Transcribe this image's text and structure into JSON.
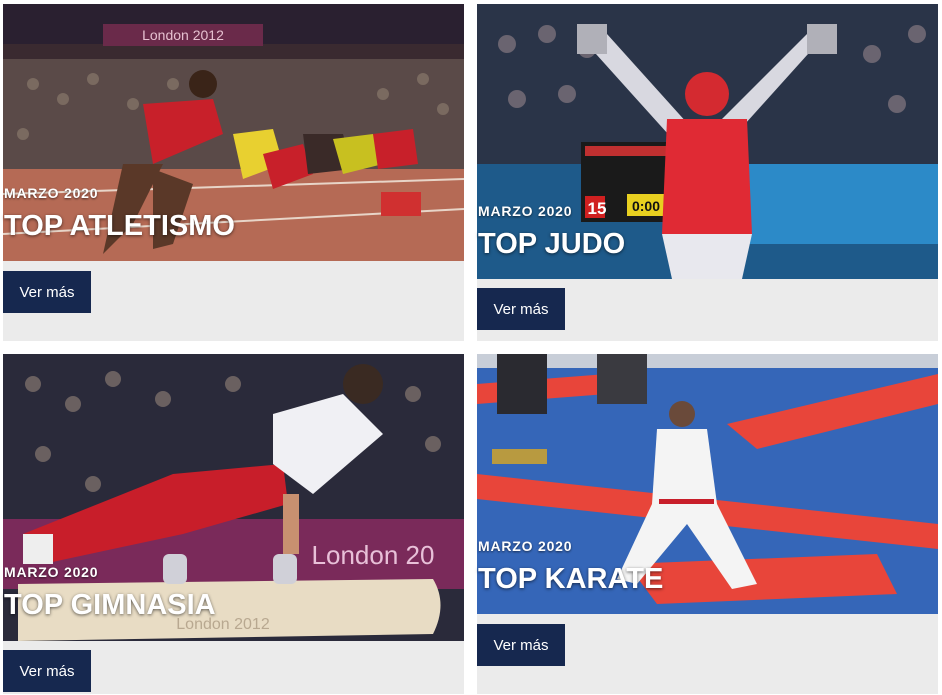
{
  "cards": [
    {
      "date": "MARZO 2020",
      "title": "TOP ATLETISMO",
      "button": "Ver más",
      "image_icon": "athletics-photo"
    },
    {
      "date": "MARZO 2020",
      "title": "TOP JUDO",
      "button": "Ver más",
      "image_icon": "judo-photo"
    },
    {
      "date": "MARZO 2020",
      "title": "TOP GIMNASIA",
      "button": "Ver más",
      "image_icon": "gymnastics-photo"
    },
    {
      "date": "MARZO 2020",
      "title": "TOP KARATE",
      "button": "Ver más",
      "image_icon": "karate-photo"
    }
  ],
  "image_text": {
    "banner_top": "London 2012",
    "banner_bottom": "London 2012",
    "banner_side": "London 20",
    "scoreboard_top": "15",
    "scoreboard_time": "0:00"
  },
  "colors": {
    "button_bg": "#16284f",
    "card_bg": "#ebebeb",
    "accent_red": "#e0303a",
    "karate_blue": "#3566b8"
  }
}
